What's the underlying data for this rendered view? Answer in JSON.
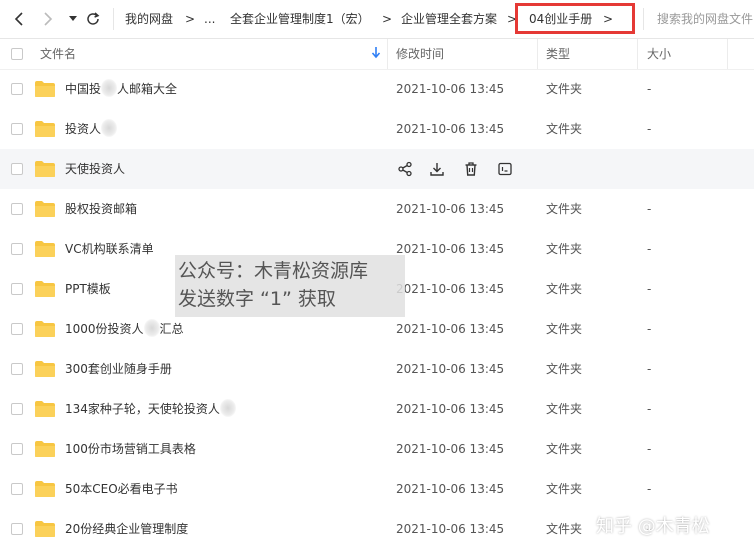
{
  "nav": {
    "breadcrumbs": [
      "我的网盘",
      "...",
      "全套企业管理制度1（宏）",
      "企业管理全套方案",
      "04创业手册"
    ],
    "arrow": ">",
    "search_placeholder": "搜索我的网盘文件"
  },
  "header": {
    "name": "文件名",
    "modified": "修改时间",
    "type": "类型",
    "size": "大小"
  },
  "files": [
    {
      "name": "中国投",
      "name_tail": "人邮箱大全",
      "time": "2021-10-06 13:45",
      "type": "文件夹",
      "size": "-"
    },
    {
      "name": "投资人",
      "name_tail": "",
      "time": "2021-10-06 13:45",
      "type": "文件夹",
      "size": "-"
    },
    {
      "name": "天使投资人",
      "name_tail": "",
      "time": "",
      "type": "",
      "size": ""
    },
    {
      "name": "股权投资邮箱",
      "name_tail": "",
      "time": "2021-10-06 13:45",
      "type": "文件夹",
      "size": "-"
    },
    {
      "name": "VC机构联系清单",
      "name_tail": "",
      "time": "2021-10-06 13:45",
      "type": "文件夹",
      "size": "-"
    },
    {
      "name": "PPT模板",
      "name_tail": "",
      "time": "2021-10-06 13:45",
      "type": "文件夹",
      "size": "-"
    },
    {
      "name": "1000份投资人",
      "name_tail": "汇总",
      "time": "2021-10-06 13:45",
      "type": "文件夹",
      "size": "-"
    },
    {
      "name": "300套创业随身手册",
      "name_tail": "",
      "time": "2021-10-06 13:45",
      "type": "文件夹",
      "size": "-"
    },
    {
      "name": "134家种子轮，天使轮投资人",
      "name_tail": "",
      "time": "2021-10-06 13:45",
      "type": "文件夹",
      "size": "-"
    },
    {
      "name": "100份市场营销工具表格",
      "name_tail": "",
      "time": "2021-10-06 13:45",
      "type": "文件夹",
      "size": "-"
    },
    {
      "name": "50本CEO必看电子书",
      "name_tail": "",
      "time": "2021-10-06 13:45",
      "type": "文件夹",
      "size": "-"
    },
    {
      "name": "20份经典企业管理制度",
      "name_tail": "",
      "time": "2021-10-06 13:45",
      "type": "文件夹",
      "size": "-"
    }
  ],
  "overlay": {
    "line1": "公众号：木青松资源库",
    "line2": "发送数字 “1” 获取"
  },
  "watermark": "知乎 @木青松",
  "colors": {
    "folder": "#f7c642",
    "highlight_box": "#e53935",
    "hover_row": "#f5f6f8"
  },
  "icons": [
    "back-icon",
    "forward-icon",
    "dropdown-icon",
    "refresh-icon",
    "sort-down-icon",
    "share-icon",
    "download-icon",
    "delete-icon",
    "more-icon",
    "folder-icon"
  ]
}
